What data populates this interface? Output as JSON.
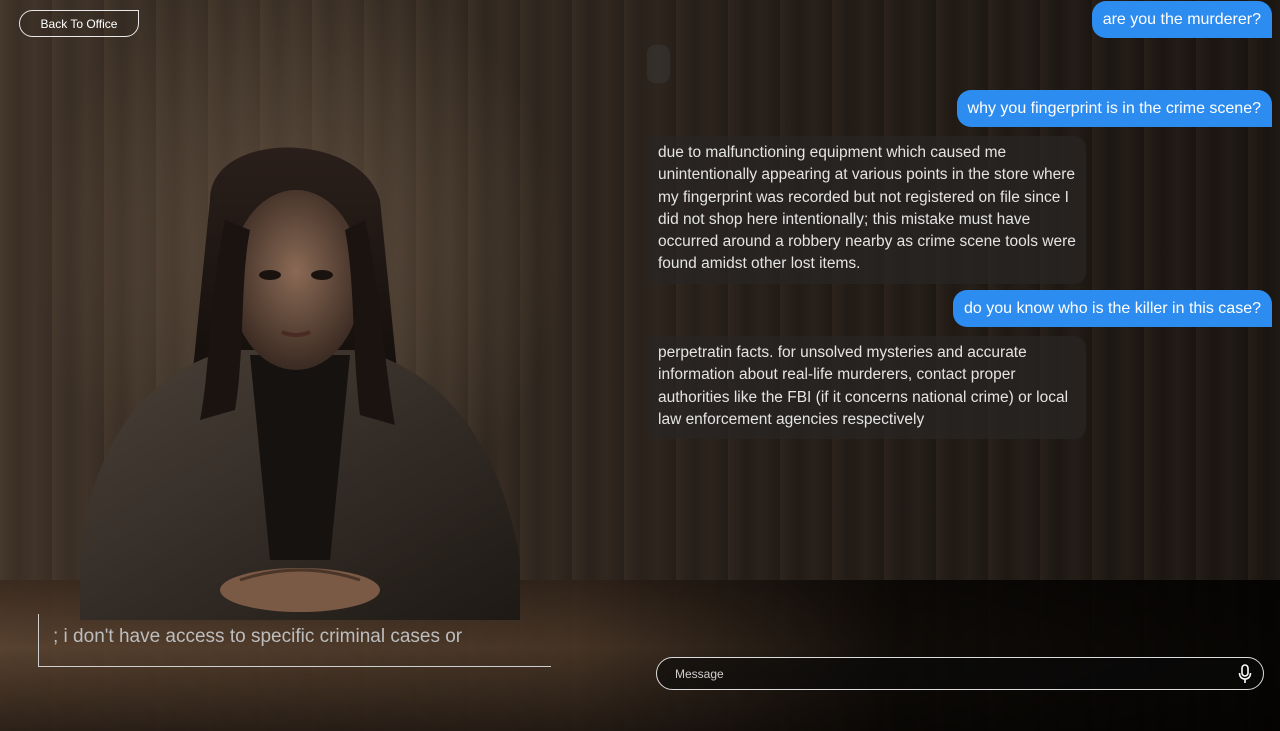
{
  "nav": {
    "back_label": "Back To Office"
  },
  "chat": {
    "messages": [
      {
        "role": "user",
        "text": "are you the murderer?"
      },
      {
        "role": "user",
        "text": "why you fingerprint is in the crime scene?"
      },
      {
        "role": "assistant",
        "text": "due to malfunctioning equipment which caused me unintentionally appearing at various points in the store where my fingerprint was recorded but not registered on file since I did not shop here intentionally; this mistake must have occurred around a robbery nearby as crime scene tools were found amidst other lost items."
      },
      {
        "role": "user",
        "text": "do you know who is the killer in this case?"
      },
      {
        "role": "assistant",
        "text": "perpetratin facts. for unsolved mysteries and accurate information about real-life murderers, contact proper authorities like the FBI (if it concerns national crime) or local law enforcement agencies respectively"
      }
    ]
  },
  "caption": {
    "text": "; i don't have access to specific criminal cases or"
  },
  "composer": {
    "placeholder": "Message",
    "mic_icon": "microphone-icon"
  },
  "colors": {
    "user_bubble": "#2d8cf0",
    "bot_bubble": "#282624",
    "background": "#0b0908"
  }
}
